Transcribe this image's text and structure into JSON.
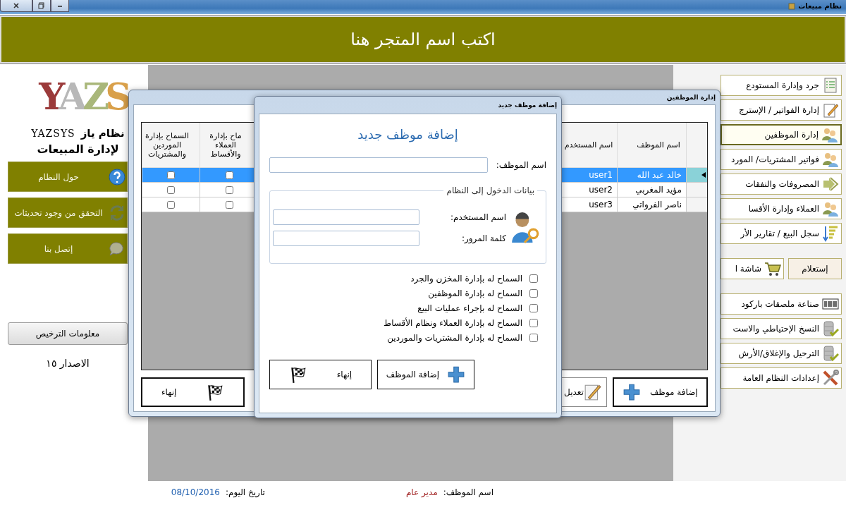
{
  "window": {
    "title": "نظام مبيعات"
  },
  "header": {
    "store_name": "اكتب اسم المتجر هنا"
  },
  "brand": {
    "logo_text": "YAZS",
    "name_ar": "نظام ياز",
    "name_en": "YAZSYS",
    "tagline": "لإدارة المبيعات"
  },
  "side_buttons": [
    {
      "label": "حول النظام",
      "kind": "help"
    },
    {
      "label": "التحقق من وجود تحديثات",
      "kind": "refresh"
    },
    {
      "label": "إتصل بنا",
      "kind": "chat"
    }
  ],
  "license_button": "معلومات الترخيص",
  "version": "الاصدار ١٥",
  "menu": {
    "main": [
      {
        "label": "جرد وإدارة المستودع",
        "kind": "checklist",
        "selected": false
      },
      {
        "label": "إدارة الفواتير / الإسترج",
        "kind": "pencil",
        "selected": false
      },
      {
        "label": "إدارة الموظفين",
        "kind": "people",
        "selected": true
      },
      {
        "label": "فواتير المشتريات/ المورد",
        "kind": "people",
        "selected": false
      },
      {
        "label": "المصروفات والنفقات",
        "kind": "arrow",
        "selected": false
      },
      {
        "label": "العملاء وإدارة الأقسا",
        "kind": "people",
        "selected": false
      },
      {
        "label": "سجل البيع / تقارير الأر",
        "kind": "report",
        "selected": false
      }
    ],
    "quick": [
      {
        "label": "إستعلام",
        "kind": "plain"
      },
      {
        "label": "شاشة ا",
        "kind": "cart"
      }
    ],
    "tools": [
      {
        "label": "صناعة ملصقات باركود",
        "kind": "barcode"
      },
      {
        "label": "النسخ الإحتياطي والاست",
        "kind": "database"
      },
      {
        "label": "الترحيل والإغلاق/الأرش",
        "kind": "database"
      },
      {
        "label": "إعدادات النظام العامة",
        "kind": "tools"
      }
    ]
  },
  "employees_window": {
    "title": "إدارة الموظفين",
    "columns_right": [
      "اسم الموظف",
      "اسم المستخدم"
    ],
    "columns_left": [
      "ماح بإدارة العملاء والأقساط",
      "السماح بإدارة الموردين والمشتريات"
    ],
    "rows": [
      {
        "name": "خالد عبد الله",
        "username": "user1",
        "selected": true,
        "customers": false,
        "suppliers": false
      },
      {
        "name": "مؤيد المغربي",
        "username": "user2",
        "selected": false,
        "customers": false,
        "suppliers": false
      },
      {
        "name": "ناصر الفرواتي",
        "username": "user3",
        "selected": false,
        "customers": false,
        "suppliers": false
      }
    ],
    "add_button": "إضافة موظف",
    "edit_button": "تعديل",
    "close_button": "إنهاء"
  },
  "dialog": {
    "title": "إضافة  موظف جديد",
    "heading": "إضافة موظف جديد",
    "employee_name_label": "اسم الموظف:",
    "login_group": "بيانات الدخول إلى النظام",
    "username_label": "اسم المستخدم:",
    "password_label": "كلمة المرور:",
    "permissions": [
      {
        "label": "السماح له بإدارة المخزن والجرد",
        "checked": false
      },
      {
        "label": "السماح له بإدارة الموظفين",
        "checked": false
      },
      {
        "label": "السماح له بإجراء عمليات البيع",
        "checked": false
      },
      {
        "label": "السماح له بإدارة العملاء ونظام الأقساط",
        "checked": false
      },
      {
        "label": "السماح له بإدارة المشتريات والموردين",
        "checked": false
      }
    ],
    "add_button": "إضافة الموظف",
    "close_button": "إنهاء"
  },
  "status": {
    "employee_label": "اسم الموظف:",
    "employee_value": "مدير عام",
    "date_label": "تاريخ اليوم:",
    "date_value": "08/10/2016"
  }
}
